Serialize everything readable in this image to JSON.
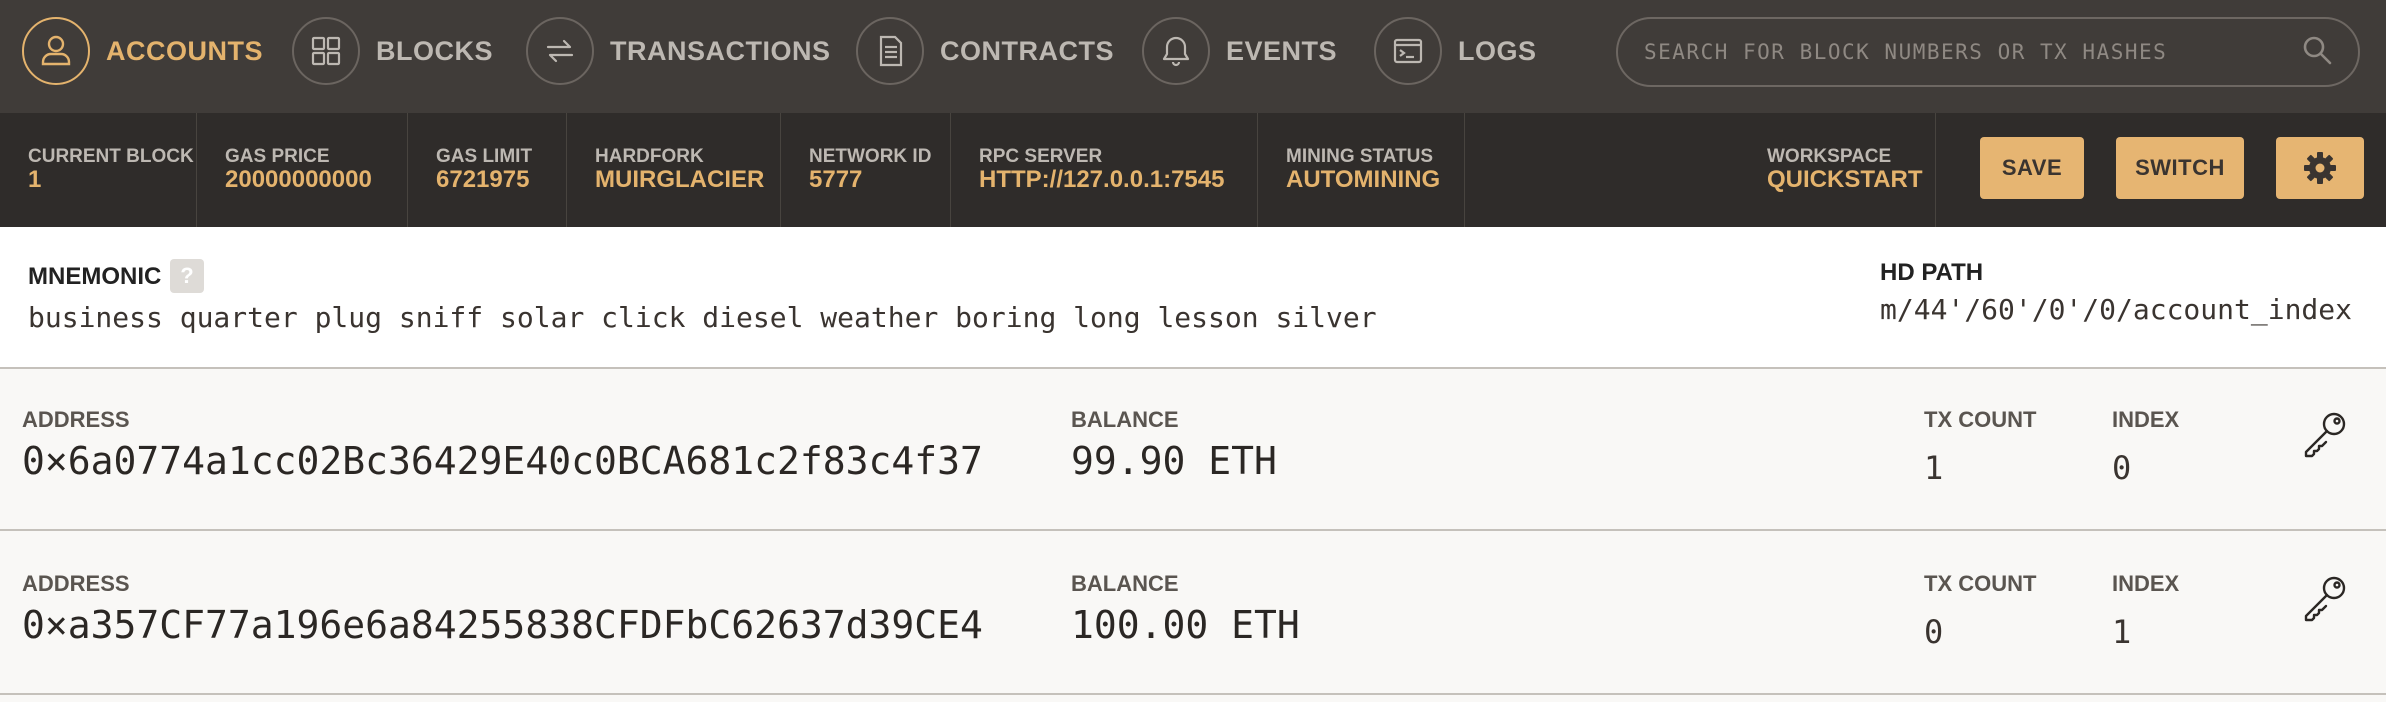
{
  "nav": {
    "items": [
      {
        "label": "ACCOUNTS",
        "icon": "user-icon",
        "active": true
      },
      {
        "label": "BLOCKS",
        "icon": "grid-icon",
        "active": false
      },
      {
        "label": "TRANSACTIONS",
        "icon": "arrows-swap-icon",
        "active": false
      },
      {
        "label": "CONTRACTS",
        "icon": "document-icon",
        "active": false
      },
      {
        "label": "EVENTS",
        "icon": "bell-icon",
        "active": false
      },
      {
        "label": "LOGS",
        "icon": "terminal-icon",
        "active": false
      }
    ],
    "search_placeholder": "SEARCH FOR BLOCK NUMBERS OR TX HASHES"
  },
  "status": {
    "current_block": {
      "label": "CURRENT BLOCK",
      "value": "1"
    },
    "gas_price": {
      "label": "GAS PRICE",
      "value": "20000000000"
    },
    "gas_limit": {
      "label": "GAS LIMIT",
      "value": "6721975"
    },
    "hardfork": {
      "label": "HARDFORK",
      "value": "MUIRGLACIER"
    },
    "network_id": {
      "label": "NETWORK ID",
      "value": "5777"
    },
    "rpc_server": {
      "label": "RPC SERVER",
      "value": "HTTP://127.0.0.1:7545"
    },
    "mining_status": {
      "label": "MINING STATUS",
      "value": "AUTOMINING"
    },
    "workspace": {
      "label": "WORKSPACE",
      "value": "QUICKSTART"
    },
    "save_label": "SAVE",
    "switch_label": "SWITCH"
  },
  "mnemonic": {
    "label": "MNEMONIC",
    "help": "?",
    "words": "business quarter plug sniff solar click diesel weather boring long lesson silver",
    "hd_path_label": "HD PATH",
    "hd_path": "m/44'/60'/0'/0/account_index"
  },
  "accounts_labels": {
    "address": "ADDRESS",
    "balance": "BALANCE",
    "tx_count": "TX COUNT",
    "index": "INDEX"
  },
  "accounts": [
    {
      "address": "0×6a0774a1cc02Bc36429E40c0BCA681c2f83c4f37",
      "balance": "99.90 ETH",
      "tx_count": "1",
      "index": "0"
    },
    {
      "address": "0×a357CF77a196e6a84255838CFDFbC62637d39CE4",
      "balance": "100.00 ETH",
      "tx_count": "0",
      "index": "1"
    }
  ],
  "colors": {
    "accent": "#e4b36d",
    "nav_bg": "#403c39",
    "status_bg": "#2f2c2a",
    "button_bg": "#e6b572"
  }
}
